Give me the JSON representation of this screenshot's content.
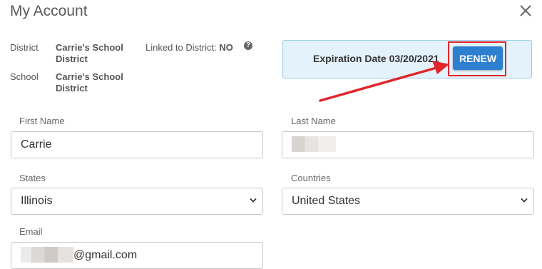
{
  "header": {
    "title": "My Account",
    "close_icon": "close-icon"
  },
  "info": {
    "district_label": "District",
    "district_value": "Carrie's School District",
    "school_label": "School",
    "school_value": "Carrie's School District",
    "linked_label": "Linked to District:",
    "linked_value": "NO",
    "help_icon": "question-circle-icon"
  },
  "expiration": {
    "text": "Expiration Date 03/20/2021",
    "renew_label": "RENEW"
  },
  "form": {
    "first_name": {
      "label": "First Name",
      "value": "Carrie"
    },
    "last_name": {
      "label": "Last Name",
      "value": ""
    },
    "states": {
      "label": "States",
      "value": "Illinois"
    },
    "countries": {
      "label": "Countries",
      "value": "United States"
    },
    "email": {
      "label": "Email",
      "value": "@gmail.com"
    }
  },
  "colors": {
    "accent": "#2f7fd0",
    "highlight": "#e0262b",
    "banner": "#e3f2fb"
  }
}
